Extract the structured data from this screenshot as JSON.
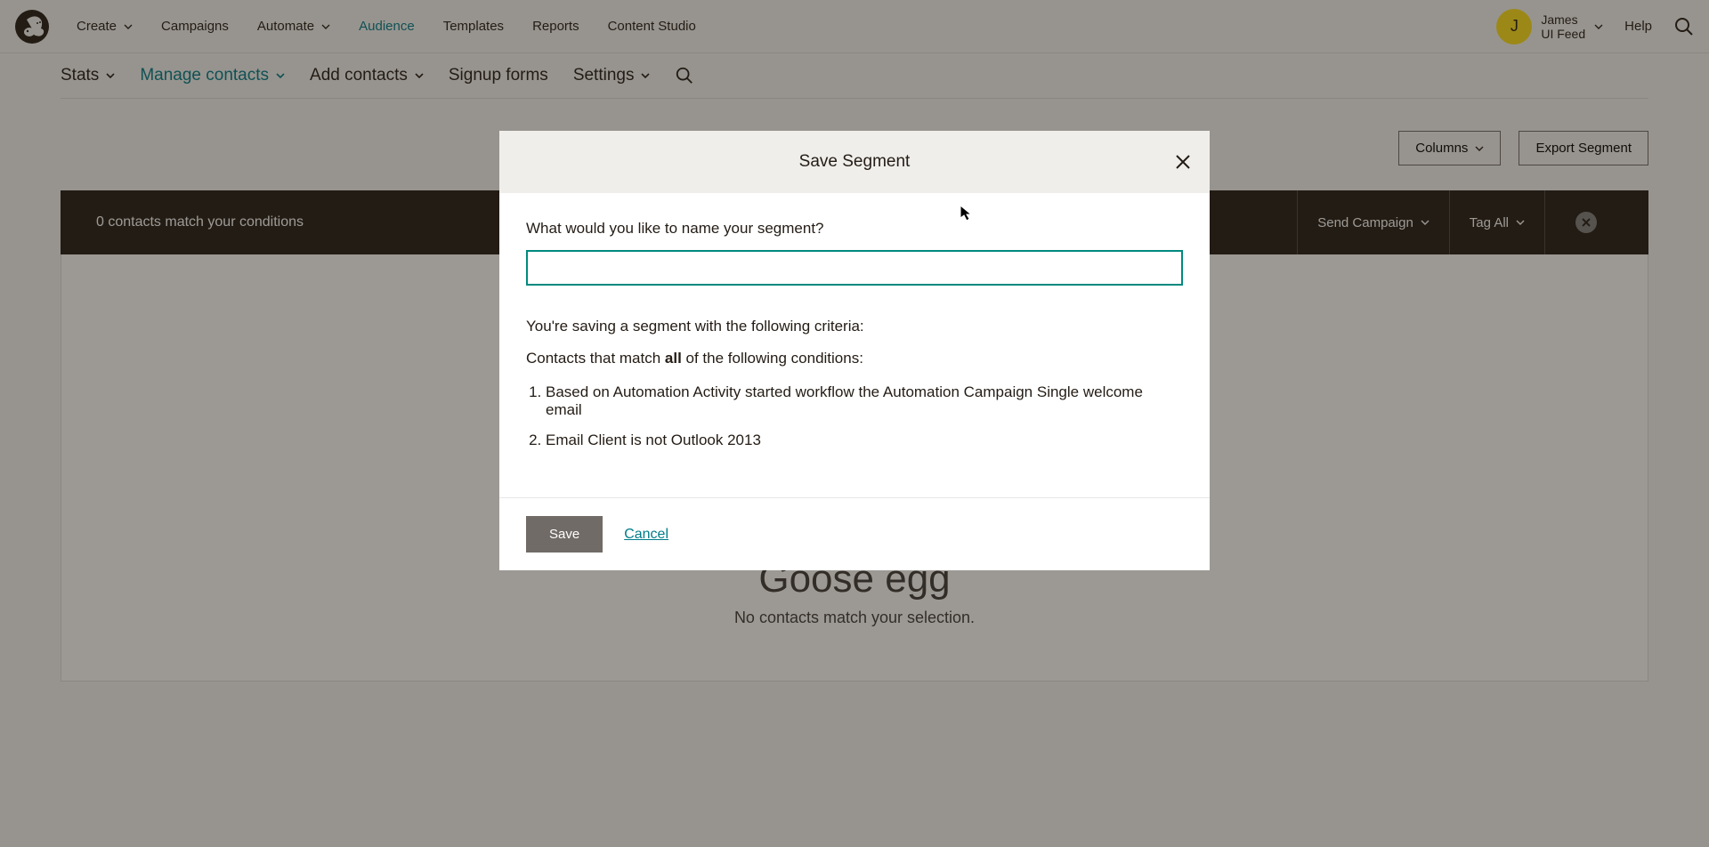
{
  "topNav": {
    "items": [
      {
        "label": "Create",
        "hasChevron": true
      },
      {
        "label": "Campaigns",
        "hasChevron": false
      },
      {
        "label": "Automate",
        "hasChevron": true
      },
      {
        "label": "Audience",
        "hasChevron": false,
        "active": true
      },
      {
        "label": "Templates",
        "hasChevron": false
      },
      {
        "label": "Reports",
        "hasChevron": false
      },
      {
        "label": "Content Studio",
        "hasChevron": false
      }
    ],
    "user": {
      "initial": "J",
      "name": "James",
      "feed": "UI Feed"
    },
    "help": "Help"
  },
  "subNav": {
    "items": [
      {
        "label": "Stats",
        "chev": true
      },
      {
        "label": "Manage contacts",
        "chev": true,
        "active": true
      },
      {
        "label": "Add contacts",
        "chev": true
      },
      {
        "label": "Signup forms",
        "chev": false
      },
      {
        "label": "Settings",
        "chev": true
      }
    ]
  },
  "toolbar": {
    "columns": "Columns",
    "export": "Export Segment"
  },
  "darkBar": {
    "matchText": "0 contacts match your conditions",
    "send": "Send Campaign",
    "tag": "Tag All"
  },
  "empty": {
    "title": "Goose egg",
    "sub": "No contacts match your selection."
  },
  "modal": {
    "title": "Save Segment",
    "label": "What would you like to name your segment?",
    "inputValue": "",
    "desc": "You're saving a segment with the following criteria:",
    "matchPrefix": "Contacts that match ",
    "matchBold": "all",
    "matchSuffix": " of the following conditions:",
    "criteria": [
      "Based on Automation Activity started workflow the Automation Campaign Single welcome email",
      "Email Client is not Outlook 2013"
    ],
    "save": "Save",
    "cancel": "Cancel"
  }
}
